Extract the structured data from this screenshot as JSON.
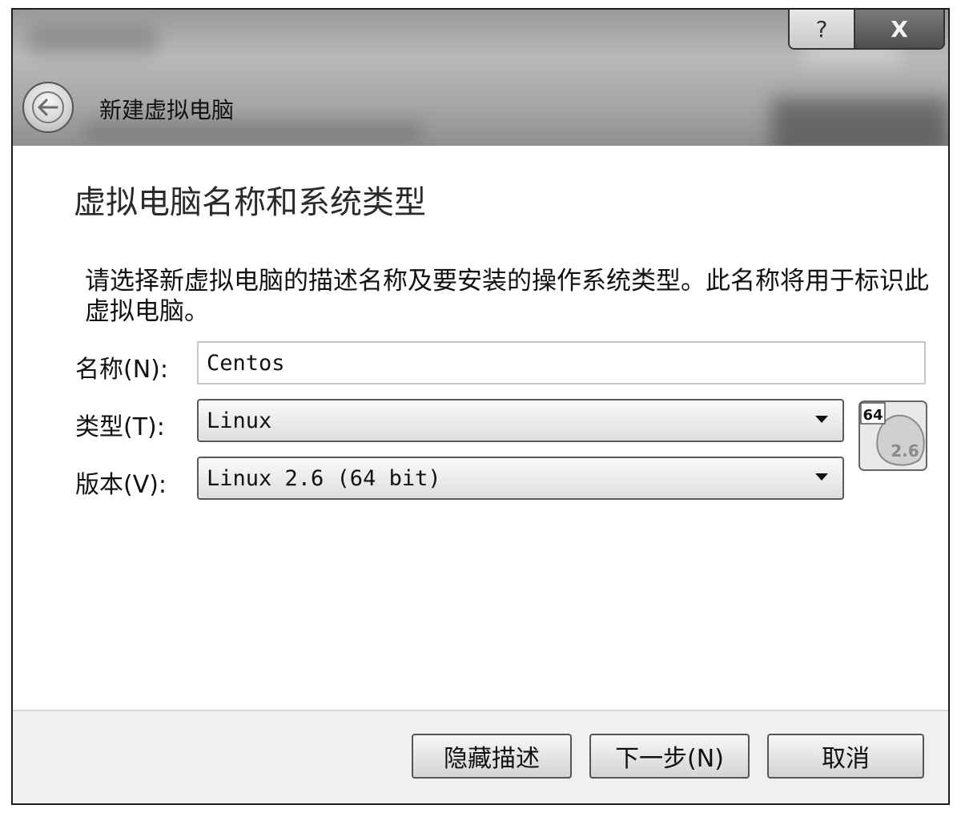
{
  "window": {
    "title": "新建虚拟电脑",
    "help_glyph": "?",
    "close_glyph": "X"
  },
  "page": {
    "heading": "虚拟电脑名称和系统类型",
    "description": "请选择新虚拟电脑的描述名称及要安装的操作系统类型。此名称将用于标识此虚拟电脑。"
  },
  "form": {
    "name_label": "名称(N):",
    "name_value": "Centos",
    "type_label": "类型(T):",
    "type_value": "Linux",
    "version_label": "版本(V):",
    "version_value": "Linux 2.6 (64 bit)"
  },
  "os_icon": {
    "name": "linux-2.6-64-icon",
    "badge": "64",
    "version": "2.6"
  },
  "footer": {
    "hide_desc_label": "隐藏描述",
    "next_label": "下一步(N)",
    "cancel_label": "取消"
  }
}
